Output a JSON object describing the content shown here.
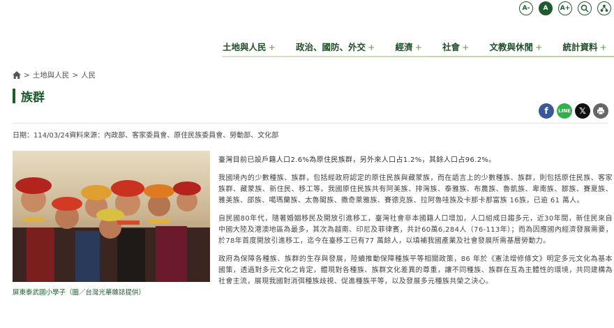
{
  "utility": {
    "font_smaller": "A-",
    "font_normal": "A",
    "font_larger": "A+"
  },
  "nav": {
    "items": [
      {
        "label": "土地與人民"
      },
      {
        "label": "政治、國防、外交"
      },
      {
        "label": "經濟"
      },
      {
        "label": "社會"
      },
      {
        "label": "文教與休閒"
      },
      {
        "label": "統計資料"
      }
    ],
    "plus": "+"
  },
  "breadcrumb": {
    "items": [
      "土地與人民",
      "人民"
    ],
    "sep": ">"
  },
  "page": {
    "title": "族群"
  },
  "share": {
    "facebook": "f",
    "line": "LINE",
    "x": "𝕏"
  },
  "meta": {
    "text": "日期：114/03/24資料來源：內政部、客家委員會、原住民族委員會、勞動部、文化部"
  },
  "photo": {
    "caption": "屏東泰武國小學子（圖／台灣光華雜誌提供）"
  },
  "article": {
    "paragraphs": [
      "臺灣目前已設戶籍人口2.6%為原住民族群，另外來人口占1.2%，其餘人口占96.2%。",
      "我國境內的少數種族、族群，包括經政府認定的原住民族與藏蒙族，而在語言上的少數種族、族群，則包括原住民族、客家族群、藏蒙族、新住民、移工等。我國原住民族共有阿美族、排灣族、泰雅族、布農族、魯凱族、卑南族、鄒族、賽夏族、雅美族、邵族、噶瑪蘭族、太魯閣族、撒奇萊雅族、賽德克族、拉阿魯哇族及卡那卡那富族 16族，已逾 61 萬人。",
      "自民國80年代，隨著婚姻移民及開放引進移工，臺灣社會非本國籍人口增加，人口組成日趨多元，近30年間，新住民來自中國大陸及港澳地區為最多，其次為越南、印尼及菲律賓，共計60萬6,284人（76-113年）；而為因應國內經濟發展需要，於78年首度開放引進移工，迄今在臺移工已有77 萬餘人，以填補我國產業及社會發展所需基層勞動力。",
      "政府為保障各種族、族群的生存與發展，陸續推動保障種族平等相關政策，86 年於《憲法增修條文》明定多元文化為基本國策，透過對多元文化之肯定，體現對各種族、族群文化差異的尊重，讓不同種族、族群在互為主體性的環境，共同建構為社會主流，展現我國對消弭種族歧視、促進種族平等，以及發展多元種族共榮之決心。"
    ]
  },
  "colors": {
    "brand_green": "#1e5b2e",
    "facebook": "#3b5998",
    "line": "#2fb24a"
  }
}
